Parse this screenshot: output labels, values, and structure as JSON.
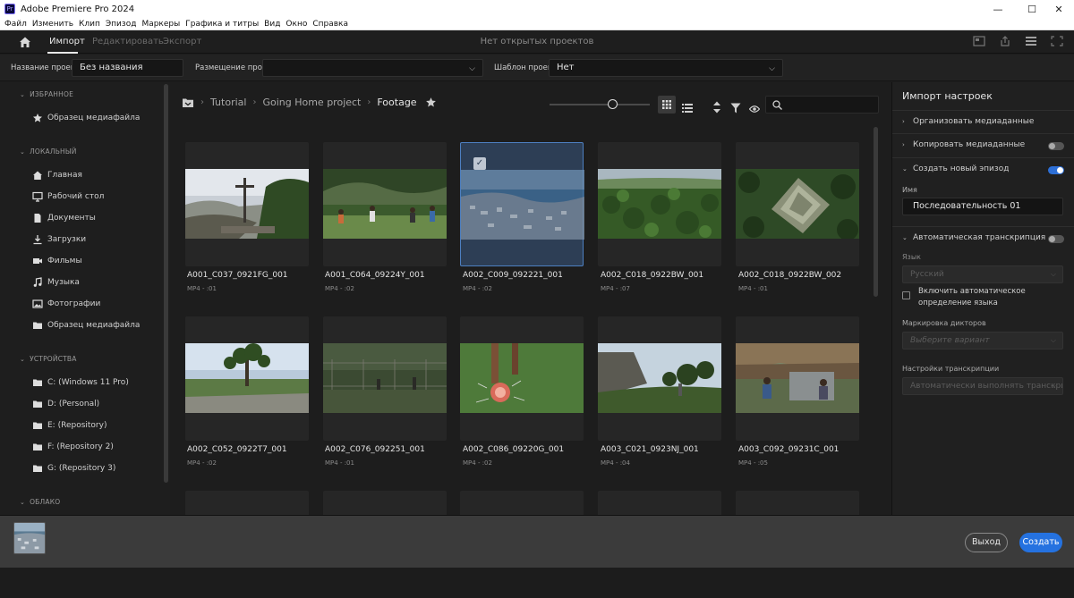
{
  "window": {
    "app_badge": "Pr",
    "title": "Adobe Premiere Pro 2024",
    "controls": [
      "—",
      "☐",
      "✕"
    ]
  },
  "menu": [
    "Файл",
    "Изменить",
    "Клип",
    "Эпизод",
    "Маркеры",
    "Графика и титры",
    "Вид",
    "Окно",
    "Справка"
  ],
  "topnav": {
    "tabs": [
      "Импорт",
      "Редактировать",
      "Экспорт"
    ],
    "active_tab": "Импорт",
    "status": "Нет открытых проектов"
  },
  "project": {
    "name_label": "Название проекта",
    "name_value": "Без названия",
    "location_label": "Размещение проекта",
    "location_value": "",
    "template_label": "Шаблон проекта",
    "template_value": "Нет"
  },
  "sidebar": {
    "favorites": {
      "title": "ИЗБРАННОЕ",
      "items": [
        {
          "label": "Образец медиафайла",
          "icon": "star-icon"
        }
      ]
    },
    "local": {
      "title": "ЛОКАЛЬНЫЙ",
      "items": [
        {
          "label": "Главная",
          "icon": "home-icon"
        },
        {
          "label": "Рабочий стол",
          "icon": "monitor-icon"
        },
        {
          "label": "Документы",
          "icon": "document-icon"
        },
        {
          "label": "Загрузки",
          "icon": "download-icon"
        },
        {
          "label": "Фильмы",
          "icon": "video-icon"
        },
        {
          "label": "Музыка",
          "icon": "music-icon"
        },
        {
          "label": "Фотографии",
          "icon": "photo-icon"
        },
        {
          "label": "Образец медиафайла",
          "icon": "folder-icon"
        }
      ]
    },
    "devices": {
      "title": "УСТРОЙСТВА",
      "items": [
        {
          "label": "C: (Windows 11 Pro)",
          "icon": "folder-icon"
        },
        {
          "label": "D: (Personal)",
          "icon": "folder-icon"
        },
        {
          "label": "E: (Repository)",
          "icon": "folder-icon"
        },
        {
          "label": "F: (Repository 2)",
          "icon": "folder-icon"
        },
        {
          "label": "G: (Repository 3)",
          "icon": "folder-icon"
        }
      ]
    },
    "cloud": {
      "title": "ОБЛАКО"
    }
  },
  "breadcrumb": {
    "items": [
      "Tutorial",
      "Going Home project",
      "Footage"
    ]
  },
  "media": [
    {
      "title": "A001_C037_0921FG_001",
      "meta": "MP4 - :01",
      "selected": false,
      "scene": "cross"
    },
    {
      "title": "A001_C064_09224Y_001",
      "meta": "MP4 - :02",
      "selected": false,
      "scene": "soccer"
    },
    {
      "title": "A002_C009_092221_001",
      "meta": "MP4 - :02",
      "selected": true,
      "scene": "city"
    },
    {
      "title": "A002_C018_0922BW_001",
      "meta": "MP4 - :07",
      "selected": false,
      "scene": "jungle"
    },
    {
      "title": "A002_C018_0922BW_002",
      "meta": "MP4 - :01",
      "selected": false,
      "scene": "ruins"
    },
    {
      "title": "A002_C052_0922T7_001",
      "meta": "MP4 - :02",
      "selected": false,
      "scene": "tree"
    },
    {
      "title": "A002_C076_092251_001",
      "meta": "MP4 - :01",
      "selected": false,
      "scene": "fence"
    },
    {
      "title": "A002_C086_09220G_001",
      "meta": "MP4 - :02",
      "selected": false,
      "scene": "ball"
    },
    {
      "title": "A003_C021_0923NJ_001",
      "meta": "MP4 - :04",
      "selected": false,
      "scene": "temple"
    },
    {
      "title": "A003_C092_09231C_001",
      "meta": "MP4 - :05",
      "selected": false,
      "scene": "hut"
    }
  ],
  "import_settings": {
    "title": "Импорт настроек",
    "organize": "Организовать медиаданные",
    "copy": "Копировать медиаданные",
    "copy_on": false,
    "new_sequence": "Создать новый эпизод",
    "new_sequence_on": true,
    "name_label": "Имя",
    "name_value": "Последовательность 01",
    "auto_transcribe": "Автоматическая транскрипция",
    "auto_transcribe_on": false,
    "language_label": "Язык",
    "language_value": "Русский",
    "auto_detect_label": "Включить автоматическое определение языка",
    "speakers_label": "Маркировка дикторов",
    "speakers_placeholder": "Выберите вариант",
    "transcribe_settings_label": "Настройки транскрипции",
    "transcribe_settings_value": "Автоматически выполнять транскри..."
  },
  "footer": {
    "exit": "Выход",
    "create": "Создать"
  },
  "colors": {
    "accent": "#2572e0",
    "selection": "#2d3e55"
  }
}
